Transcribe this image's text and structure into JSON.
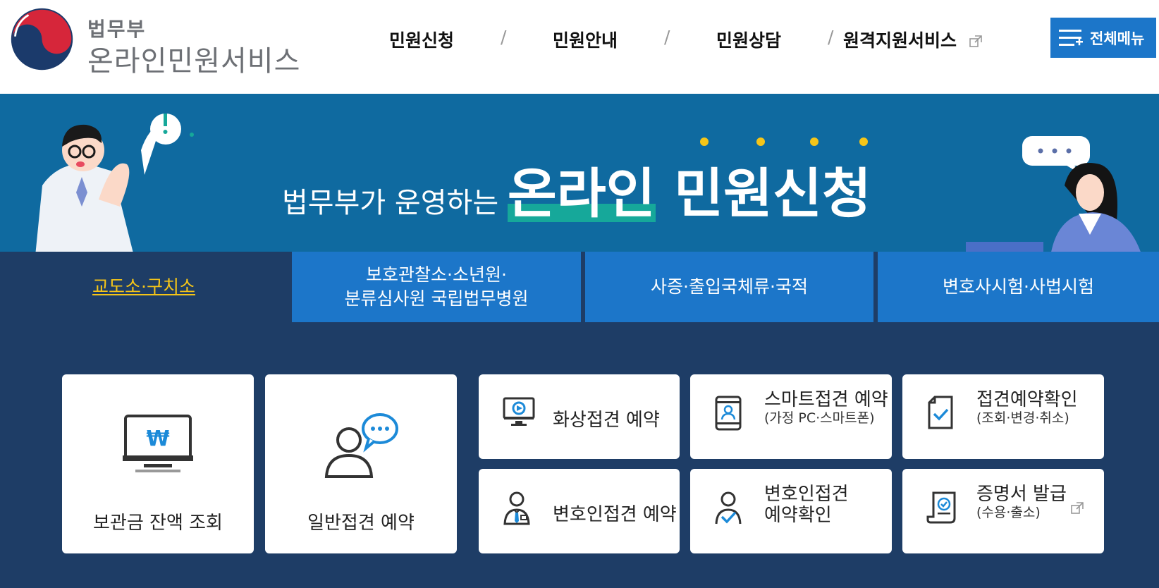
{
  "colors": {
    "primary_blue": "#1c76c9",
    "banner_blue": "#0f6aa0",
    "dark_navy": "#1e3d66",
    "active_yellow": "#f5c518",
    "highlight_teal": "#16a89a"
  },
  "logo": {
    "sub": "법무부",
    "main": "온라인민원서비스"
  },
  "nav": {
    "items": [
      "민원신청",
      "민원안내",
      "민원상담",
      "원격지원서비스"
    ],
    "separator": "/"
  },
  "menu_button": {
    "label": "전체메뉴"
  },
  "banner": {
    "lead": "법무부가 운영하는 ",
    "highlight": "온라인",
    "rest": " 민원신청"
  },
  "tabs": [
    {
      "label": "교도소·구치소",
      "active": true
    },
    {
      "label_line1": "보호관찰소·소년원·",
      "label_line2": "분류심사원 국립법무병원",
      "active": false
    },
    {
      "label": "사증·출입국체류·국적",
      "active": false
    },
    {
      "label": "변호사시험·사법시험",
      "active": false
    }
  ],
  "cards": {
    "balance": "보관금 잔액 조회",
    "general_visit": "일반접견 예약",
    "video_visit": "화상접견 예약",
    "smart_visit": {
      "title": "스마트접견 예약",
      "sub": "(가정 PC·스마트폰)"
    },
    "visit_confirm": {
      "title": "접견예약확인",
      "sub": "(조회·변경·취소)"
    },
    "lawyer_visit": "변호인접견 예약",
    "lawyer_confirm": {
      "line1": "변호인접견",
      "line2": "예약확인"
    },
    "certificate": {
      "title": "증명서 발급",
      "sub": "(수용·출소)"
    }
  },
  "icons": {
    "logo": "taegeuk-logo",
    "menu": "hamburger-plus-icon",
    "external": "external-link-icon",
    "monitor_won": "monitor-won-icon",
    "person_chat": "person-chat-icon",
    "video_monitor": "video-monitor-icon",
    "smartphone_person": "smartphone-person-icon",
    "document_check": "document-check-icon",
    "lawyer": "lawyer-icon",
    "person_check": "person-check-icon",
    "scroll_certificate": "scroll-certificate-icon",
    "currency_symbol": "₩"
  }
}
